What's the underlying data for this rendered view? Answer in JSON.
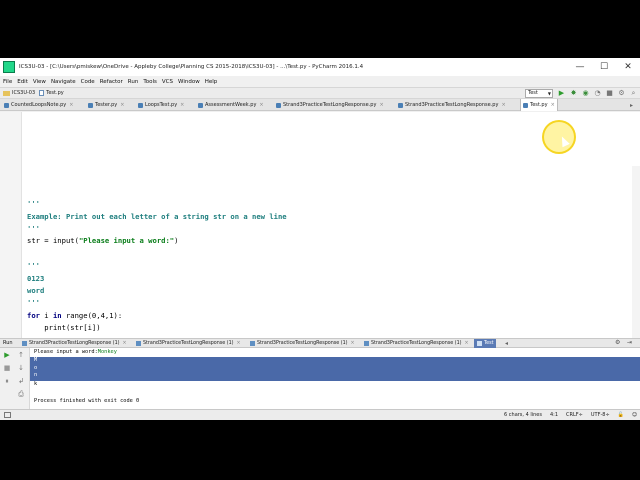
{
  "window": {
    "title": "ICS3U-03 - [C:\\Users\\pmiskew\\OneDrive - Appleby College\\Planning CS 2015-2018\\ICS3U-03] - ...\\Test.py - PyCharm 2016.1.4",
    "controls": {
      "minimize": "—",
      "maximize": "☐",
      "close": "✕"
    }
  },
  "menu": [
    "File",
    "Edit",
    "View",
    "Navigate",
    "Code",
    "Refactor",
    "Run",
    "Tools",
    "VCS",
    "Window",
    "Help"
  ],
  "breadcrumb": {
    "project": "ICS3U-03",
    "file": "Test.py"
  },
  "run_config": {
    "label": "Test"
  },
  "editor_tabs": [
    {
      "label": "CountedLoopsNote.py"
    },
    {
      "label": "Tester.py"
    },
    {
      "label": "LoopsTest.py"
    },
    {
      "label": "AssessmentWeek.py"
    },
    {
      "label": "Strand3PracticeTestLongResponse.py"
    },
    {
      "label": "Strand3PracticeTestLongResponse.py"
    },
    {
      "label": "Test.py"
    }
  ],
  "code": {
    "l1": "'''",
    "l2": "Example: Print out each letter of a string str on a new line",
    "l3": "'''",
    "l4a": "str = input(",
    "l4b": "\"Please input a word:\"",
    "l4c": ")",
    "l5": "'''",
    "l6": "0123",
    "l7": "word",
    "l8": "'''",
    "l9a": "for",
    "l9b": " i ",
    "l9c": "in",
    "l9d": " range(0,4,1):",
    "l10": "    print(str[i])"
  },
  "run": {
    "label": "Run",
    "tabs": [
      {
        "label": "Strand3PracticeTestLongResponse (1)"
      },
      {
        "label": "Strand3PracticeTestLongResponse (1)"
      },
      {
        "label": "Strand3PracticeTestLongResponse (1)"
      },
      {
        "label": "Strand3PracticeTestLongResponse (1)"
      },
      {
        "label": "Test"
      }
    ],
    "console": {
      "prompt": "Please input a word:",
      "typed": "Monkey",
      "out": [
        "M",
        "o",
        "n",
        "k"
      ],
      "finish": "Process finished with exit code 0"
    }
  },
  "status": {
    "position": "6 chars, 4 lines",
    "caret": "4:1",
    "line_sep": "CRLF÷",
    "encoding": "UTF-8÷"
  }
}
